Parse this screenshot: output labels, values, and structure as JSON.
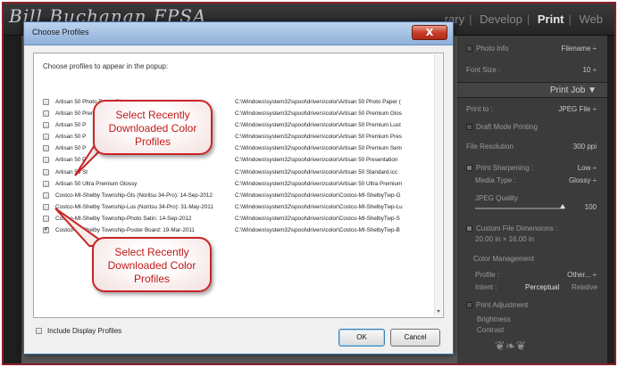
{
  "lightroom": {
    "signature": "Bill Buchanan FPSA",
    "modules": [
      "rary",
      "Develop",
      "Print",
      "Web"
    ],
    "active_module": "Print",
    "right_panel": {
      "photo_info_label": "Photo Info",
      "photo_info_value": "Filename ÷",
      "font_size_label": "Font Size :",
      "font_size_value": "10 ÷",
      "print_job_header": "Print Job ▼",
      "print_to_label": "Print to :",
      "print_to_value": "JPEG File ÷",
      "draft_mode_label": "Draft Mode Printing",
      "file_resolution_label": "File Resolution",
      "file_resolution_value": "300 ppi",
      "print_sharpening_label": "Print Sharpening :",
      "print_sharpening_value": "Low ÷",
      "media_type_label": "Media Type :",
      "media_type_value": "Glossy ÷",
      "jpeg_quality_label": "JPEG Quality",
      "jpeg_quality_value": "100",
      "custom_dims_label": "Custom File Dimensions :",
      "custom_dims_value": "20.00 in   ×   16.00 in",
      "color_management_label": "Color Management",
      "profile_label": "Profile :",
      "profile_value": "Other... ÷",
      "intent_label": "Intent :",
      "intent_perceptual": "Perceptual",
      "intent_relative": "Relative",
      "print_adjustment_label": "Print Adjustment",
      "brightness_label": "Brightness",
      "contrast_label": "Contrast"
    }
  },
  "dialog": {
    "title": "Choose Profiles",
    "close_label": "X",
    "instruction": "Choose profiles to appear in the popup:",
    "profiles": [
      {
        "name": "Artisan 50 Photo Paper Glossy",
        "path": "C:\\Windows\\system32\\spool\\drivers\\color\\Artisan 50 Photo Paper (",
        "checked": false
      },
      {
        "name": "Artisan 50 Premium Glossy",
        "path": "C:\\Windows\\system32\\spool\\drivers\\color\\Artisan 50 Premium Glos",
        "checked": false
      },
      {
        "name": "Artisan 50 P",
        "path": "C:\\Windows\\system32\\spool\\drivers\\color\\Artisan 50 Premium Lust",
        "checked": false
      },
      {
        "name": "Artisan 50 P",
        "path": "C:\\Windows\\system32\\spool\\drivers\\color\\Artisan 50 Premium Pres",
        "checked": false
      },
      {
        "name": "Artisan 50 P",
        "path": "C:\\Windows\\system32\\spool\\drivers\\color\\Artisan 50 Premium Sem",
        "checked": false
      },
      {
        "name": "Artisan 50 P",
        "path": "C:\\Windows\\system32\\spool\\drivers\\color\\Artisan 50 Presentation",
        "checked": false
      },
      {
        "name": "Artisan 50 St",
        "path": "C:\\Windows\\system32\\spool\\drivers\\color\\Artisan 50 Standard.icc",
        "checked": false
      },
      {
        "name": "Artisan 50 Ultra Premium Glossy",
        "path": "C:\\Windows\\system32\\spool\\drivers\\color\\Artisan 50 Ultra Premium",
        "checked": false
      },
      {
        "name": "Costco-MI-Shelby Township-Gls (Noritsu 34-Pro): 14-Sep-2012",
        "path": "C:\\Windows\\system32\\spool\\drivers\\color\\Costco-MI-ShelbyTwp-G",
        "checked": false
      },
      {
        "name": "Costco-MI-Shelby Township-Lus (Noritsu 34-Pro): 31-May-2011",
        "path": "C:\\Windows\\system32\\spool\\drivers\\color\\Costco-MI-ShelbyTwp-Lu",
        "checked": false
      },
      {
        "name": "Costco-MI-Shelby Township-Photo Satin: 14-Sep-2012",
        "path": "C:\\Windows\\system32\\spool\\drivers\\color\\Costco-MI-ShelbyTwp-S",
        "checked": false
      },
      {
        "name": "Costco-MI-Shelby Township-Poster Board: 19-Mar-2011",
        "path": "C:\\Windows\\system32\\spool\\drivers\\color\\Costco-MI-ShelbyTwp-B",
        "checked": true
      }
    ],
    "include_display_label": "Include Display Profiles",
    "ok_label": "OK",
    "cancel_label": "Cancel"
  },
  "callouts": {
    "top": [
      "Select Recently",
      "Downloaded Color",
      "Profiles"
    ],
    "bottom": [
      "Select Recently",
      "Downloaded Color",
      "Profiles"
    ]
  },
  "colors": {
    "callout_red": "#c72525",
    "frame_border": "#8a1f2a",
    "titlebar_blue": "#8fb0d9",
    "close_red": "#c83f2a"
  }
}
